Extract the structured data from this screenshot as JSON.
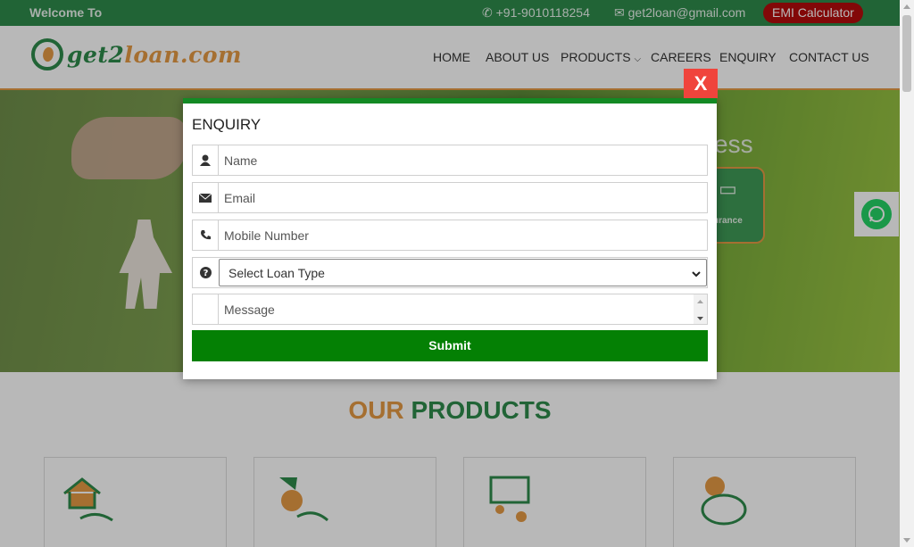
{
  "topbar": {
    "welcome": "Welcome To",
    "phone": "+91-9010118254",
    "email": "get2loan@gmail.com",
    "emi_button": "EMI Calculator"
  },
  "logo": {
    "text_green": "get2",
    "text_orange": "loan.com"
  },
  "nav": {
    "items": [
      {
        "label": "HOME"
      },
      {
        "label": "ABOUT US"
      },
      {
        "label": "PRODUCTS"
      },
      {
        "label": "CAREERS"
      },
      {
        "label": "ENQUIRY"
      },
      {
        "label": "CONTACT US"
      }
    ]
  },
  "hero": {
    "partial_heading": "ess",
    "card_label": "urance"
  },
  "products": {
    "title_orange": "OUR",
    "title_green": "PRODUCTS"
  },
  "modal": {
    "title": "ENQUIRY",
    "close_label": "X",
    "name_placeholder": "Name",
    "email_placeholder": "Email",
    "mobile_placeholder": "Mobile Number",
    "loan_type_selected": "Select Loan Type",
    "message_placeholder": "Message",
    "submit_label": "Submit"
  },
  "colors": {
    "brand_green": "#2e8b4c",
    "brand_orange": "#e59a45",
    "submit_green": "#048004",
    "close_red": "#f0443c"
  }
}
